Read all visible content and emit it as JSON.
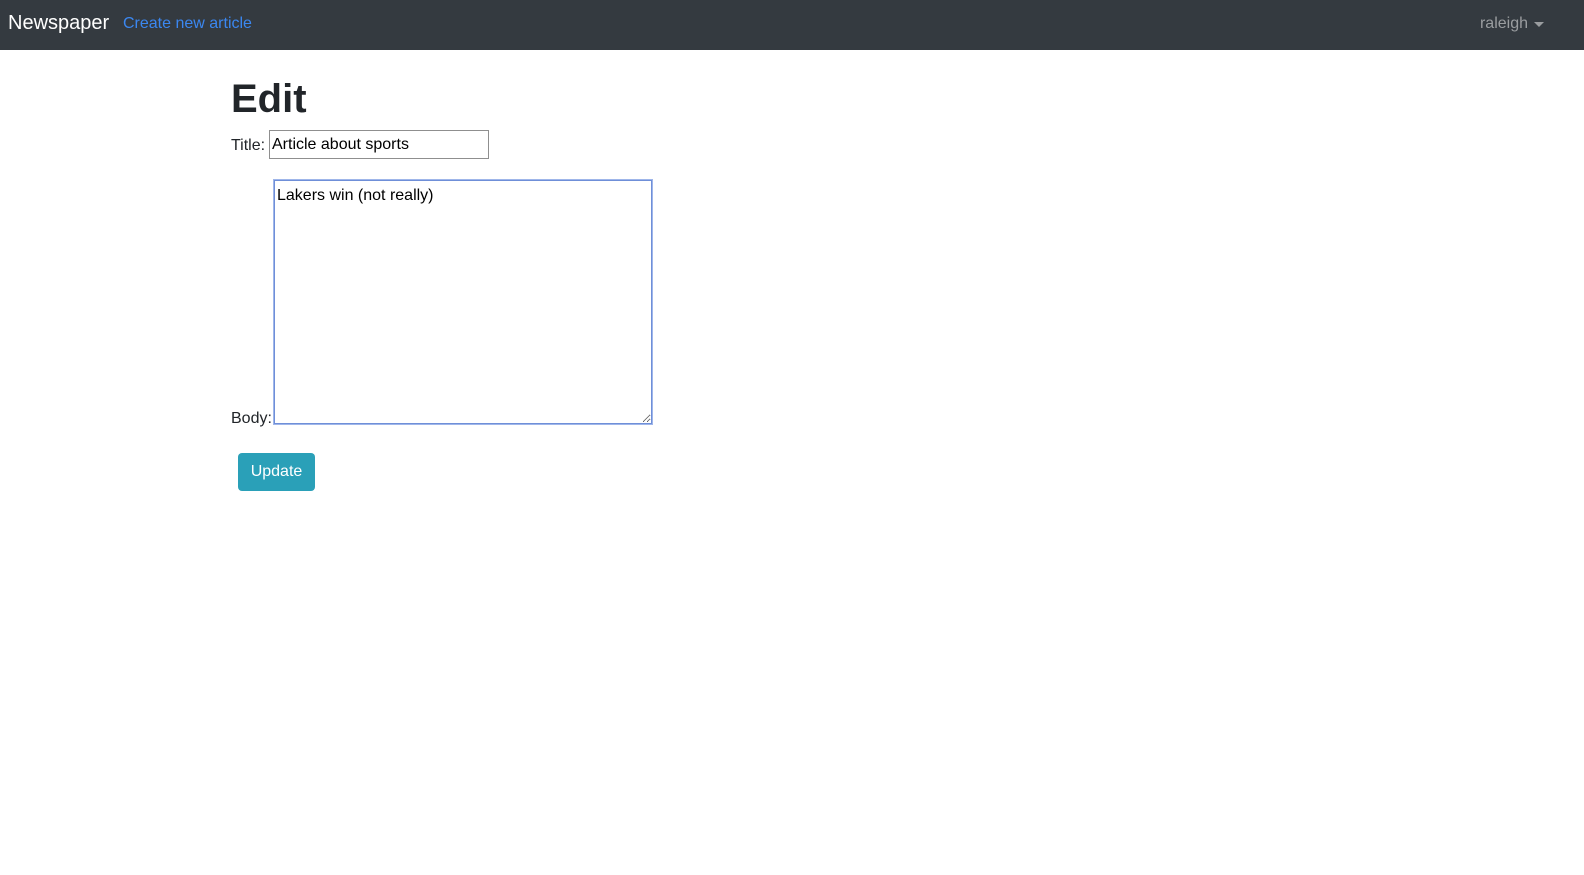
{
  "navbar": {
    "brand": "Newspaper",
    "create_link": "Create new article",
    "user": "raleigh"
  },
  "page": {
    "title": "Edit"
  },
  "form": {
    "title_label": "Title:",
    "title_value": "Article about sports",
    "body_label": "Body:",
    "body_value": "Lakers win (not really)",
    "submit_label": "Update"
  },
  "colors": {
    "navbar_bg": "#343a40",
    "link": "#3b87f0",
    "button_bg": "#2aa0b8"
  }
}
